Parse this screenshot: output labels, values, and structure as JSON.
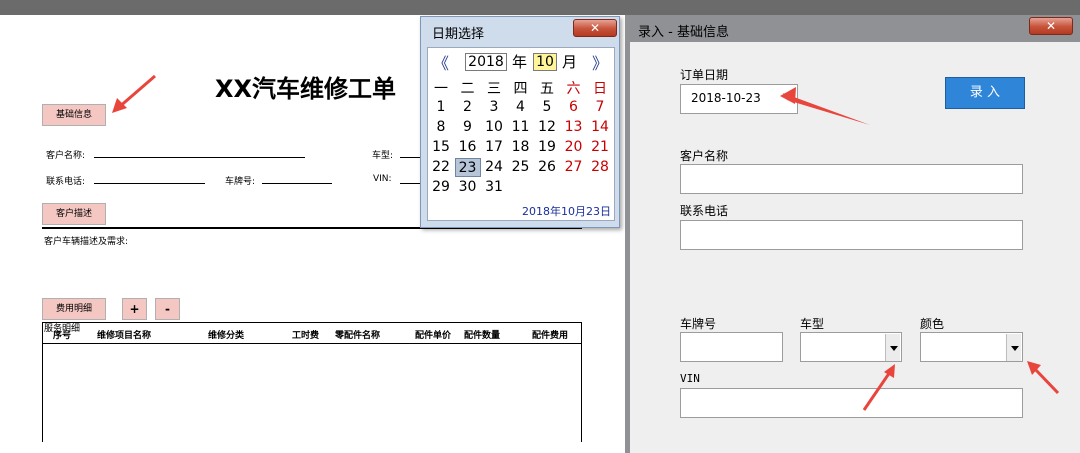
{
  "sheet": {
    "title": "XX汽车维修工单",
    "basic_info_button": "基础信息",
    "customer_name_label": "客户名称:",
    "car_model_label": "车型:",
    "phone_label": "联系电话:",
    "plate_label": "车牌号:",
    "vin_label": "VIN:",
    "customer_desc_button": "客户描述",
    "desc_label": "客户车辆描述及需求:",
    "cost_detail_button": "费用明细",
    "plus_button": "+",
    "minus_button": "-",
    "service_label": "服务明细",
    "table_headers": [
      "序号",
      "维修项目名称",
      "维修分类",
      "工时费",
      "零配件名称",
      "配件单价",
      "配件数量",
      "配件费用"
    ]
  },
  "datepicker": {
    "title": "日期选择",
    "close": "✕",
    "year": "2018",
    "year_suffix": "年",
    "month": "10",
    "month_suffix": "月",
    "prev": "《",
    "next": "》",
    "weekdays": [
      "一",
      "二",
      "三",
      "四",
      "五",
      "六",
      "日"
    ],
    "days": [
      "1",
      "2",
      "3",
      "4",
      "5",
      "6",
      "7",
      "8",
      "9",
      "10",
      "11",
      "12",
      "13",
      "14",
      "15",
      "16",
      "17",
      "18",
      "19",
      "20",
      "21",
      "22",
      "23",
      "24",
      "25",
      "26",
      "27",
      "28",
      "29",
      "30",
      "31"
    ],
    "selected_day": "23",
    "footer": "2018年10月23日"
  },
  "form": {
    "window_title": "录入 - 基础信息",
    "close": "✕",
    "order_date_label": "订单日期",
    "order_date_value": "2018-10-23",
    "submit_button": "录 入",
    "customer_name_label": "客户名称",
    "customer_name_value": "",
    "phone_label": "联系电话",
    "phone_value": "",
    "plate_label": "车牌号",
    "plate_value": "",
    "model_label": "车型",
    "color_label": "颜色",
    "vin_label": "VIN",
    "vin_value": ""
  },
  "colors": {
    "pink_button": "#f4c7c3",
    "blue_button": "#2f86d8",
    "annotation_arrow": "#e8453c",
    "weekend_red": "#c80000"
  }
}
